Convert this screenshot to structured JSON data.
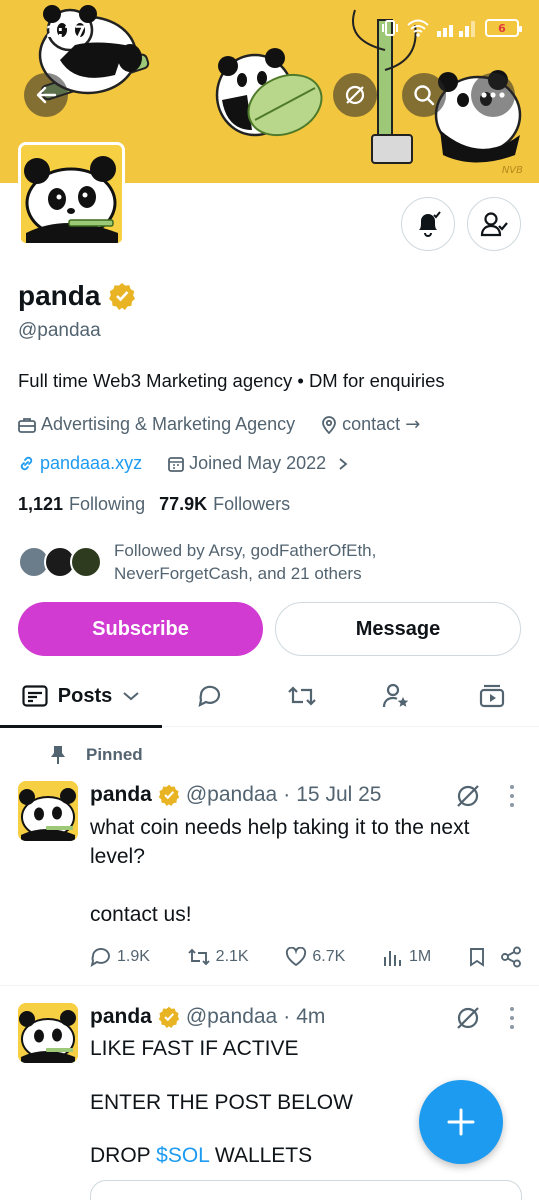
{
  "status_bar": {
    "time": "2:17",
    "battery_level": "6",
    "battery_color": "#e03b3b"
  },
  "header": {
    "back_icon": "arrow-left-icon",
    "grok_icon": "slash-circle-icon",
    "search_icon": "search-icon",
    "more_icon": "more-horizontal-icon",
    "banner_watermark": "NVB",
    "banner_color": "#f3c63f"
  },
  "profile": {
    "name": "panda",
    "verified_badge_color": "#e8b423",
    "handle": "@pandaa",
    "bio": "Full time Web3 Marketing agency • DM for enquiries",
    "category": "Advertising & Marketing Agency",
    "location": "contact",
    "location_arrow": "→",
    "website": "pandaaa.xyz",
    "joined": "Joined May 2022",
    "following_count": "1,121",
    "following_label": "Following",
    "followers_count": "77.9K",
    "followers_label": "Followers",
    "followed_by": "Followed by Arsy, godFatherOfEth, NeverForgetCash, and 21 others"
  },
  "actions": {
    "subscribe_label": "Subscribe",
    "subscribe_color": "#d13bd1",
    "message_label": "Message"
  },
  "tabs": {
    "posts_label": "Posts",
    "icons": [
      "reply-bubble-icon",
      "repost-icon",
      "user-star-icon",
      "media-video-icon"
    ]
  },
  "posts": [
    {
      "pinned_label": "Pinned",
      "name": "panda",
      "handle": "@pandaa",
      "separator": "·",
      "time": "15 Jul 25",
      "text": "what coin needs help taking it to the next level?\n\ncontact us!",
      "replies": "1.9K",
      "reposts": "2.1K",
      "likes": "6.7K",
      "views": "1M"
    },
    {
      "name": "panda",
      "handle": "@pandaa",
      "separator": "·",
      "time": "4m",
      "text_line1": "LIKE FAST IF ACTIVE",
      "text_line2": "ENTER THE POST BELOW",
      "text_line3_pre": "DROP ",
      "cashtag": "$SOL",
      "text_line3_post": " WALLETS"
    }
  ],
  "fab": {
    "icon": "plus-icon",
    "color": "#1d9bf0"
  }
}
